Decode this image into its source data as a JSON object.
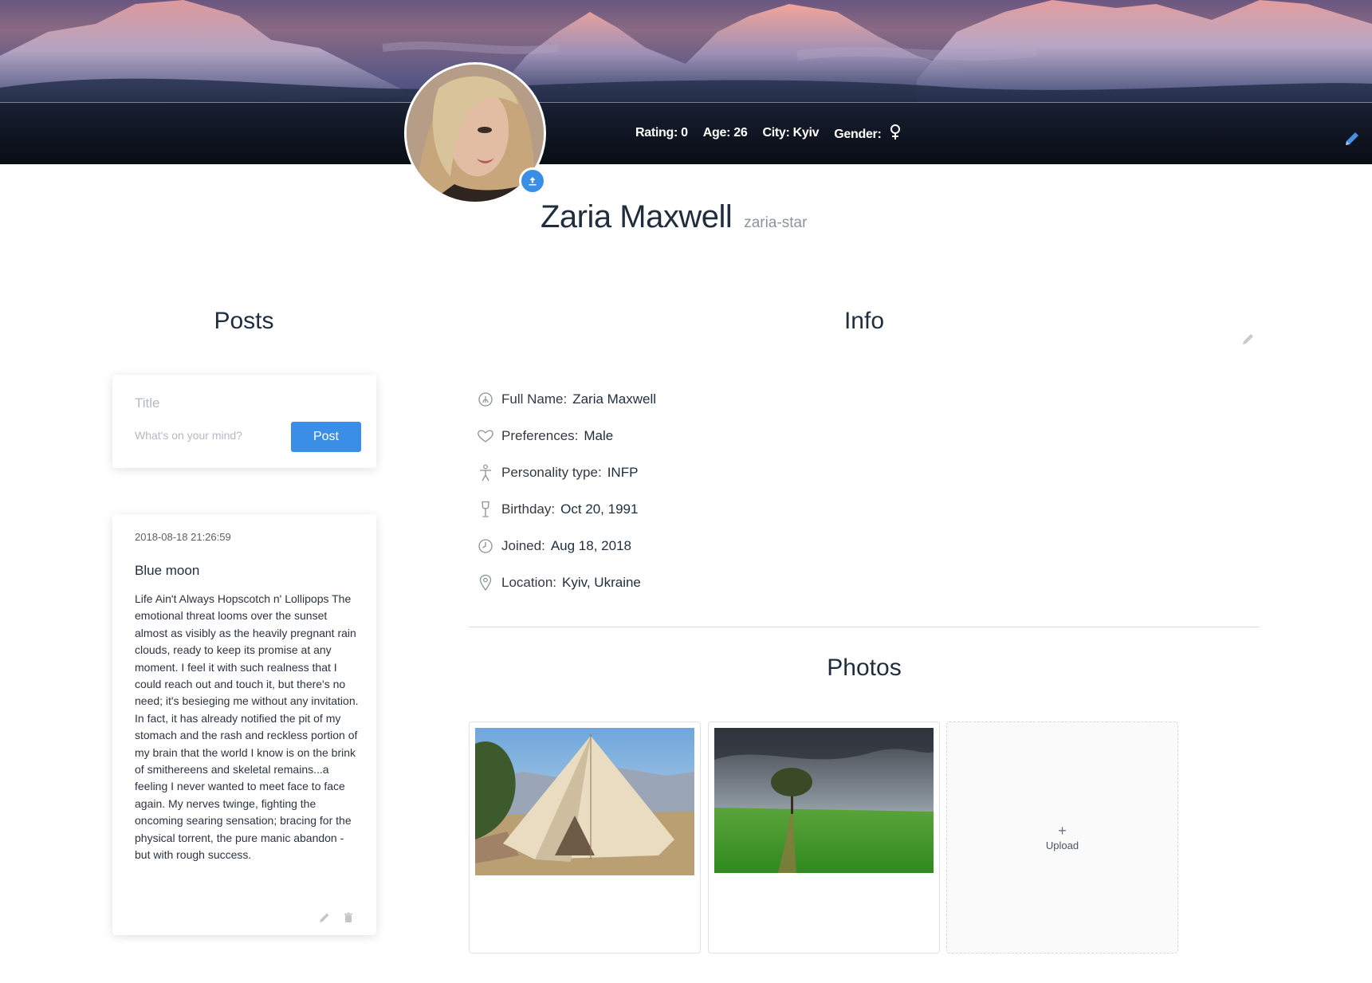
{
  "header": {
    "stats": [
      {
        "text": "Rating: 0"
      },
      {
        "text": "Age: 26"
      },
      {
        "text": "City: Kyiv"
      },
      {
        "text": "Gender:"
      }
    ],
    "gender_icon": "female-symbol-icon",
    "edit_icon": "pencil-icon"
  },
  "profile": {
    "name": "Zaria Maxwell",
    "username": "zaria-star",
    "avatar_alt": "avatar",
    "upload_icon": "upload-icon"
  },
  "posts": {
    "heading": "Posts",
    "form": {
      "title_placeholder": "Title",
      "text_placeholder": "What's on your mind?",
      "submit_label": "Post"
    },
    "items": [
      {
        "date": "2018-08-18 21:26:59",
        "title": "Blue moon",
        "body": "Life Ain't Always Hopscotch n' Lollipops The emotional threat looms over the sunset almost as visibly as the heavily pregnant rain clouds, ready to keep its promise at any moment. I feel it with such realness that I could reach out and touch it, but there's no need; it's besieging me without any invitation. In fact, it has already notified the pit of my stomach and the rash and reckless portion of my brain that the world I know is on the brink of smithereens and skeletal remains...a feeling I never wanted to meet face to face again. My nerves twinge, fighting the oncoming searing sensation; bracing for the physical torrent, the pure manic abandon - but with rough success."
      }
    ]
  },
  "info": {
    "heading": "Info",
    "rows": [
      {
        "icon": "fingerprint-icon",
        "label": "Full Name:",
        "value": "Zaria Maxwell"
      },
      {
        "icon": "heart-icon",
        "label": "Preferences:",
        "value": "Male"
      },
      {
        "icon": "person-icon",
        "label": "Personality type:",
        "value": "INFP"
      },
      {
        "icon": "wine-glass-icon",
        "label": "Birthday:",
        "value": "Oct 20, 1991"
      },
      {
        "icon": "clock-icon",
        "label": "Joined:",
        "value": "Aug 18, 2018"
      },
      {
        "icon": "location-pin-icon",
        "label": "Location:",
        "value": "Kyiv, Ukraine"
      }
    ]
  },
  "photos": {
    "heading": "Photos",
    "items": [
      {
        "subject": "bell tent in a field"
      },
      {
        "subject": "tree in a green field"
      }
    ],
    "upload_label": "Upload"
  },
  "colors": {
    "accent": "#3a8ee6",
    "text": "#1f2d3d",
    "muted": "#8c939d"
  }
}
